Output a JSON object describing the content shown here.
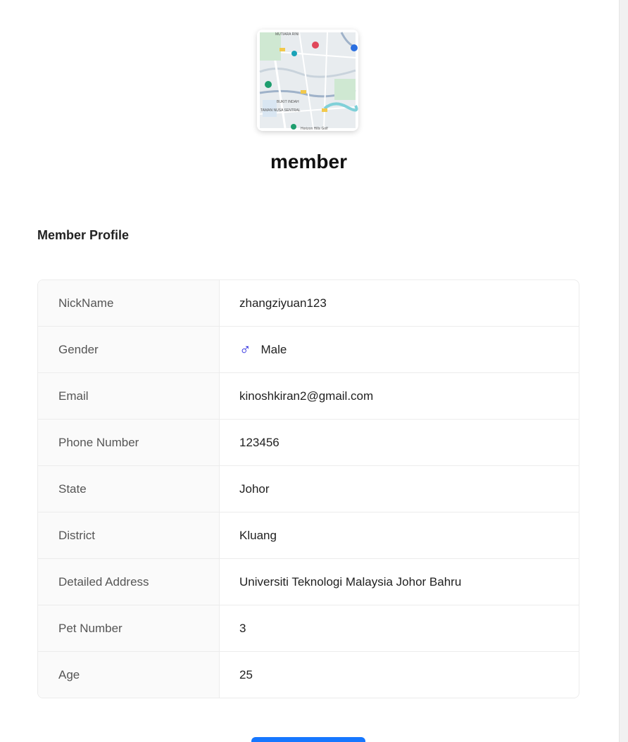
{
  "header": {
    "username": "member"
  },
  "profile": {
    "section_title": "Member Profile",
    "rows": [
      {
        "label": "NickName",
        "value": "zhangziyuan123"
      },
      {
        "label": "Gender",
        "value": "Male"
      },
      {
        "label": "Email",
        "value": "kinoshkiran2@gmail.com"
      },
      {
        "label": "Phone Number",
        "value": "123456"
      },
      {
        "label": "State",
        "value": "Johor"
      },
      {
        "label": "District",
        "value": "Kluang"
      },
      {
        "label": "Detailed Address",
        "value": "Universiti Teknologi Malaysia Johor Bahru"
      },
      {
        "label": "Pet Number",
        "value": "3"
      },
      {
        "label": "Age",
        "value": "25"
      }
    ],
    "gender_icon": "male-icon"
  },
  "map_avatar": {
    "label_top": "MUTIARA RINI",
    "label_mid": "BUKIT INDAH",
    "label_left": "TAMAN NUSA SENTRAL",
    "label_bottom": "Horizon Hills Golf"
  },
  "colors": {
    "accent": "#1677ff",
    "male": "#1d1ddc"
  }
}
